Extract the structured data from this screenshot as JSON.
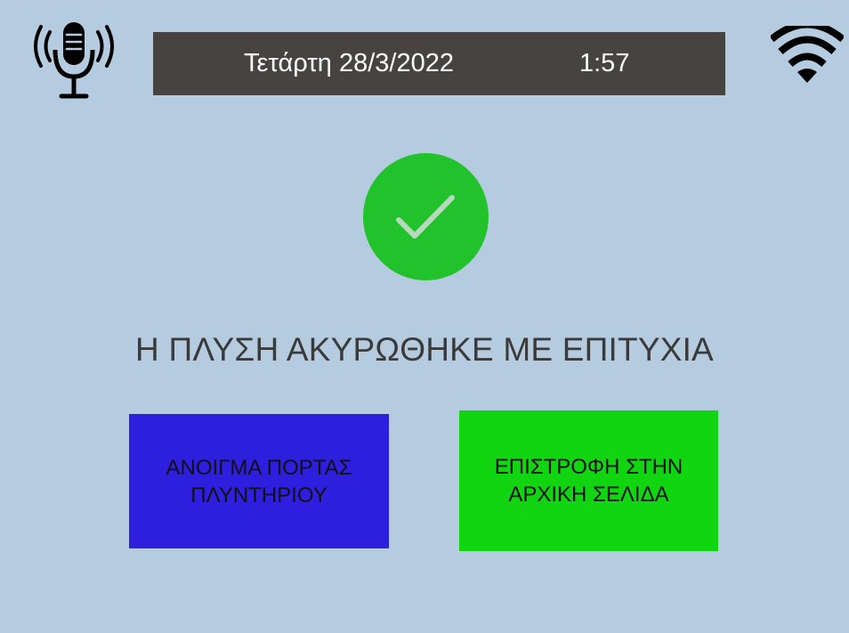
{
  "header": {
    "date": "Τετάρτη 28/3/2022",
    "time": "1:57"
  },
  "icons": {
    "left": "microphone-icon",
    "right": "wifi-icon",
    "status": "checkmark-icon"
  },
  "message": "Η ΠΛΥΣΗ ΑΚΥΡΩΘΗΚΕ ΜΕ ΕΠΙΤΥΧΙΑ",
  "buttons": {
    "open_door": "ΑΝΟΙΓΜΑ ΠΟΡΤΑΣ ΠΛΥΝΤΗΡΙΟΥ",
    "return_home": "ΕΠΙΣΤΡΟΦΗ ΣΤΗΝ ΑΡΧΙΚΗ ΣΕΛΙΔΑ"
  },
  "colors": {
    "background": "#b5cce0",
    "status_bar": "#474343",
    "success": "#22c22c",
    "open_door_button": "#2d1fdd",
    "return_home_button": "#12d512"
  }
}
